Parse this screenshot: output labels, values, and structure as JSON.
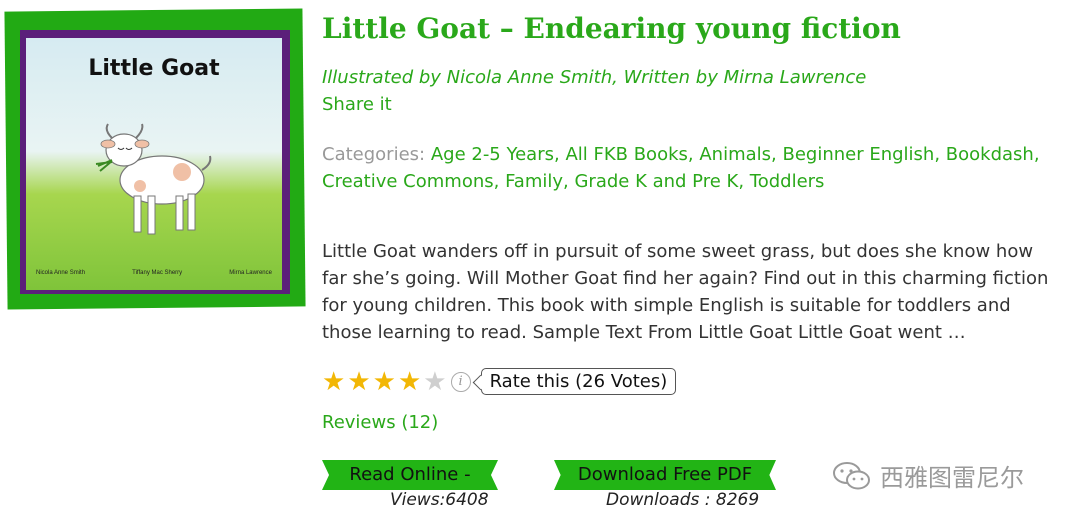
{
  "book": {
    "cover": {
      "title": "Little Goat",
      "credits": [
        "Nicola Anne Smith",
        "Tiffany Mac Sherry",
        "Mirna Lawrence"
      ],
      "colors": {
        "border": "#22aa14",
        "inner_border": "#5b1f7a"
      }
    },
    "title": "Little Goat – Endearing young fiction",
    "byline": "Illustrated by Nicola Anne Smith, Written by Mirna Lawrence",
    "share_label": "Share it",
    "categories_label": "Categories:",
    "categories": [
      "Age 2-5 Years",
      "All FKB Books",
      "Animals",
      "Beginner English",
      "Bookdash",
      "Creative Commons",
      "Family",
      "Grade K and Pre K",
      "Toddlers"
    ],
    "description": "Little Goat wanders off in pursuit of some sweet grass, but does she know how far she’s going. Will Mother Goat find her again? Find out in this charming fiction for young children. This book with simple English is suitable for toddlers and those learning to read. Sample Text From Little Goat Little Goat went …",
    "rating": {
      "value": 4,
      "max": 5,
      "rate_label": "Rate this (26 Votes)",
      "info_icon": "info-icon"
    },
    "reviews_label": "Reviews (12)",
    "read_button": "Read Online -",
    "views": "Views:6408",
    "download_button": "Download Free PDF",
    "downloads": "Downloads : 8269"
  },
  "watermark": {
    "text": "西雅图雷尼尔",
    "icon": "wechat-icon"
  },
  "colors": {
    "accent": "#2aa81a",
    "button": "#22b415",
    "star": "#f2b705",
    "muted": "#999999"
  }
}
